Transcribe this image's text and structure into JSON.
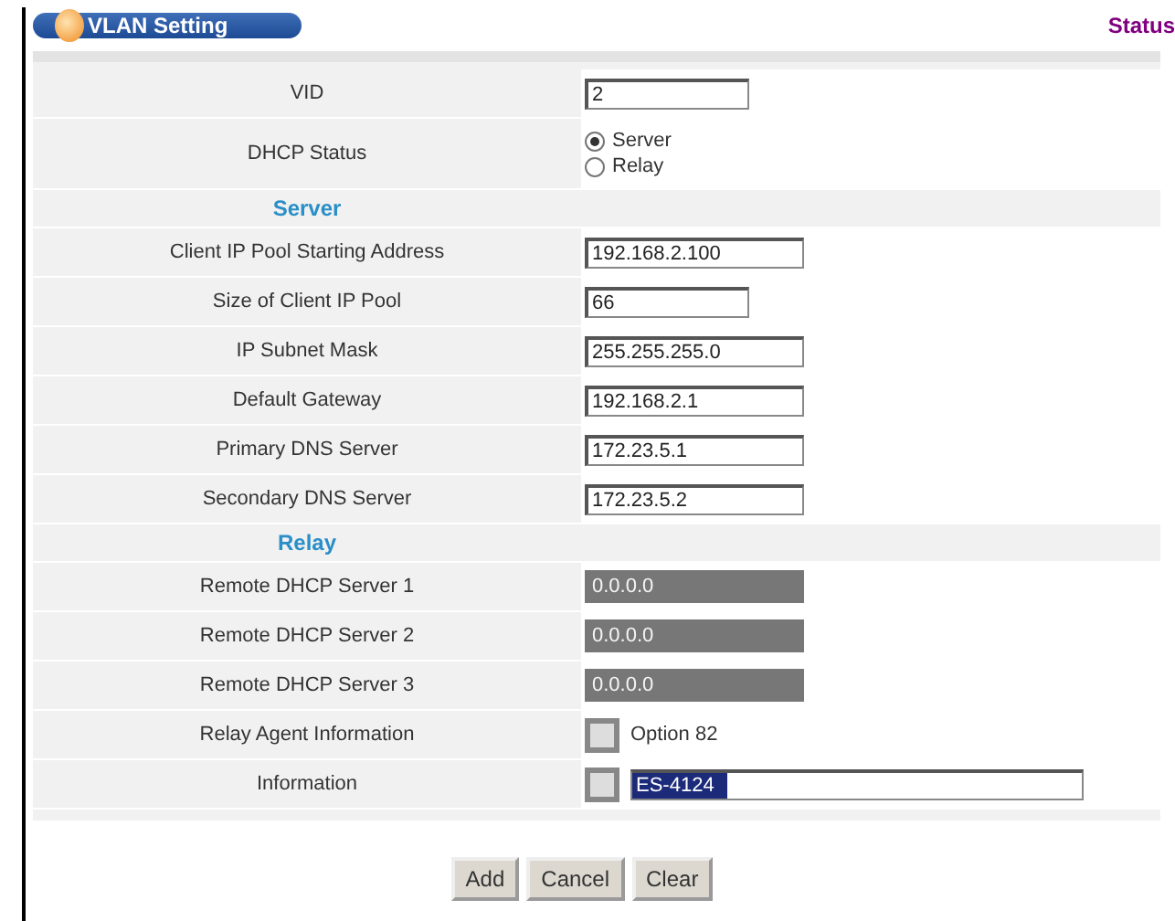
{
  "header": {
    "title": "VLAN Setting",
    "link": "Status"
  },
  "rows": [
    {
      "kind": "text",
      "label": "VID",
      "value": "2"
    },
    {
      "kind": "radio",
      "label": "DHCP Status",
      "options": [
        {
          "label": "Server",
          "selected": true
        },
        {
          "label": "Relay",
          "selected": false
        }
      ]
    },
    {
      "kind": "heading",
      "label": "Server"
    },
    {
      "kind": "text",
      "label": "Client IP Pool Starting Address",
      "value": "192.168.2.100"
    },
    {
      "kind": "text",
      "label": "Size of Client IP Pool",
      "value": "66"
    },
    {
      "kind": "text",
      "label": "IP Subnet Mask",
      "value": "255.255.255.0"
    },
    {
      "kind": "text",
      "label": "Default Gateway",
      "value": "192.168.2.1"
    },
    {
      "kind": "text",
      "label": "Primary DNS Server",
      "value": "172.23.5.1"
    },
    {
      "kind": "text",
      "label": "Secondary DNS Server",
      "value": "172.23.5.2"
    },
    {
      "kind": "heading",
      "label": "Relay"
    },
    {
      "kind": "disabled",
      "label": "Remote DHCP Server 1",
      "value": "0.0.0.0"
    },
    {
      "kind": "disabled",
      "label": "Remote DHCP Server 2",
      "value": "0.0.0.0"
    },
    {
      "kind": "disabled",
      "label": "Remote DHCP Server 3",
      "value": "0.0.0.0"
    },
    {
      "kind": "checkbox",
      "label": "Relay Agent Information",
      "option": "Option 82",
      "checked": false
    },
    {
      "kind": "checkfield",
      "label": "Information",
      "value": "ES-4124",
      "checked": false
    }
  ],
  "buttons": [
    "Add",
    "Cancel",
    "Clear"
  ]
}
